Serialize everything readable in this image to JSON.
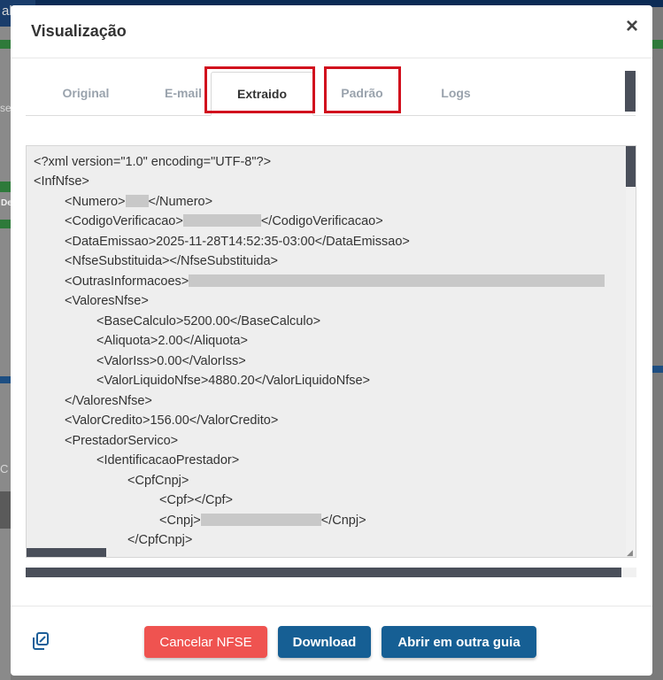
{
  "modal": {
    "title": "Visualização",
    "close_label": "×"
  },
  "tabs": [
    {
      "label": "Original"
    },
    {
      "label": "E-mail"
    },
    {
      "label": "Extraido"
    },
    {
      "label": "Padrão"
    },
    {
      "label": "Logs"
    }
  ],
  "active_tab": "Extraido",
  "code": {
    "lines": [
      "<?xml version=\"1.0\" encoding=\"UTF-8\"?>",
      "<InfNfse>",
      "<Numero>",
      "</Numero>",
      "<CodigoVerificacao>",
      "</CodigoVerificacao>",
      "<DataEmissao>2025-11-28T14:52:35-03:00</DataEmissao>",
      "<NfseSubstituida></NfseSubstituida>",
      "<OutrasInformacoes>",
      "<ValoresNfse>",
      "<BaseCalculo>5200.00</BaseCalculo>",
      "<Aliquota>2.00</Aliquota>",
      "<ValorIss>0.00</ValorIss>",
      "<ValorLiquidoNfse>4880.20</ValorLiquidoNfse>",
      "</ValoresNfse>",
      "<ValorCredito>156.00</ValorCredito>",
      "<PrestadorServico>",
      "<IdentificacaoPrestador>",
      "<CpfCnpj>",
      "<Cpf></Cpf>",
      "<Cnpj>",
      "</Cnpj>",
      "</CpfCnpj>"
    ]
  },
  "footer": {
    "cancel_label": "Cancelar NFSE",
    "download_label": "Download",
    "open_label": "Abrir em outra guia"
  },
  "background": {
    "fragments": [
      "alat",
      "se",
      "De",
      "C"
    ]
  },
  "colors": {
    "cancel": "#ef5350",
    "primary": "#165f94",
    "highlight": "#d10f1d"
  },
  "icons": {
    "copy": "copy-icon",
    "close": "close-icon"
  }
}
